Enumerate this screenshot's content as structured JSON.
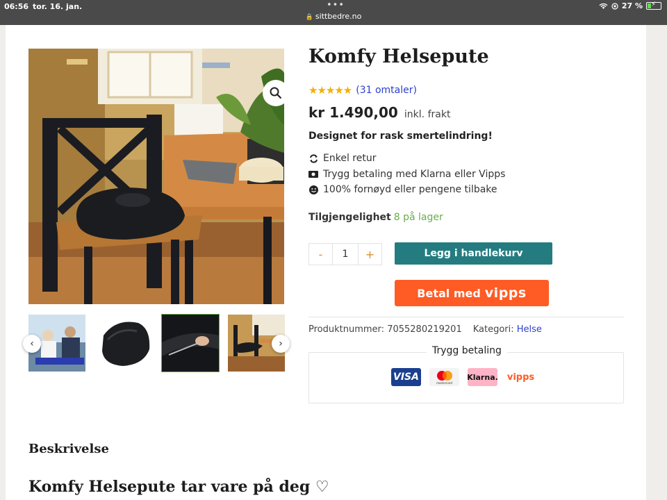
{
  "status": {
    "time": "06:56",
    "date": "tor. 16. jan.",
    "url": "sittbedre.no",
    "battery": "27 %",
    "battery_level": 0.27
  },
  "product": {
    "title": "Komfy Helsepute",
    "rating": 5,
    "reviews": "(31 omtaler)",
    "price": "kr 1.490,00",
    "price_suffix": "inkl. frakt",
    "tagline": "Designet for rask smertelindring!",
    "features": [
      {
        "icon": "refresh-icon",
        "text": "Enkel retur"
      },
      {
        "icon": "money-icon",
        "text": "Trygg betaling med Klarna eller Vipps"
      },
      {
        "icon": "smile-icon",
        "text": "100% fornøyd eller pengene tilbake"
      }
    ],
    "stock_label": "Tilgjengelighet",
    "stock_value": "8 på lager",
    "quantity": "1",
    "minus": "-",
    "plus": "+",
    "add_to_cart": "Legg i handlekurv",
    "vipps_pay": "Betal med",
    "vipps_logo": "vipps",
    "sku_label": "Produktnummer:",
    "sku": "7055280219201",
    "category_label": "Kategori:",
    "category": "Helse"
  },
  "secure_payment": {
    "title": "Trygg betaling",
    "logos": [
      "VISA",
      "mastercard",
      "Klarna.",
      "vipps"
    ]
  },
  "description": {
    "heading": "Beskrivelse",
    "subheading": "Komfy Helsepute tar vare på deg ♡"
  },
  "colors": {
    "status_bar": "#4a4a4a",
    "add_button": "#247c80",
    "vipps": "#ff5b24",
    "stars": "#f4b000",
    "link": "#2c3fcf",
    "in_stock": "#6aac4b"
  }
}
